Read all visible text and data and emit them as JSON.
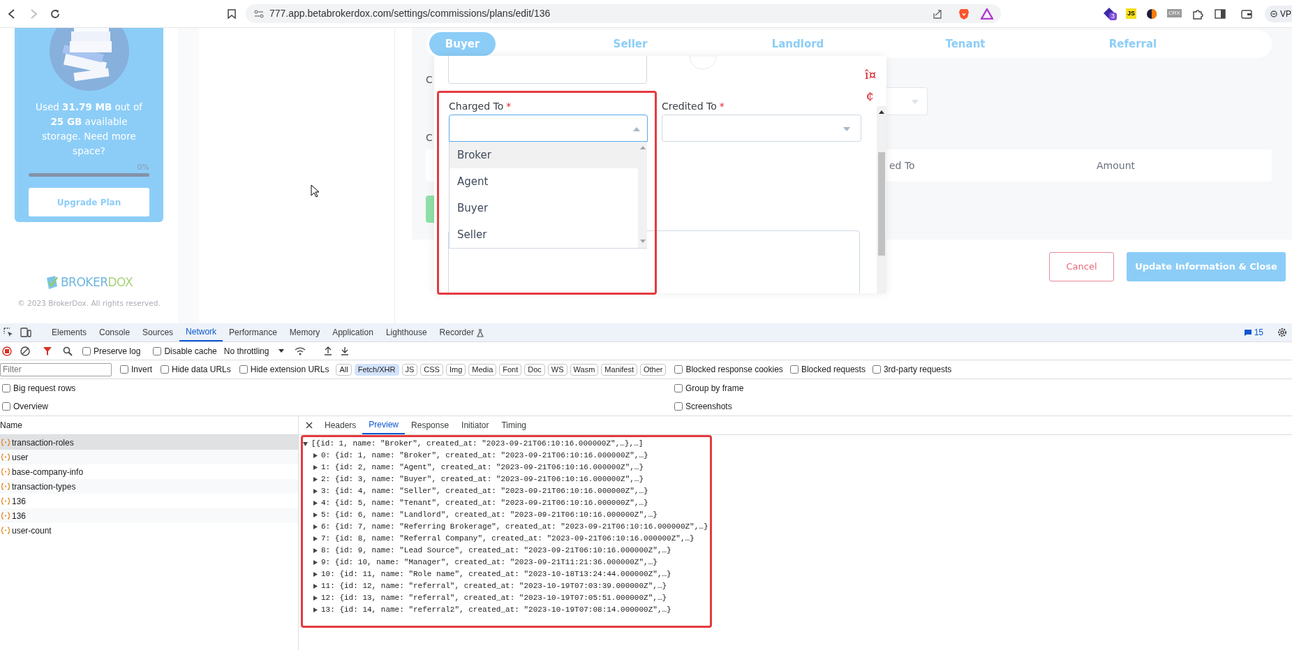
{
  "browser": {
    "url": "777.app.betabrokerdox.com/settings/commissions/plans/edit/136",
    "extension_badge": "3",
    "js_label": "JS",
    "crx_label": "CRX",
    "profile_button": "VP"
  },
  "sidebar": {
    "storage_text": "Used **31.79 MB** out of **25 GB** available storage. Need more space?",
    "usage_percent": "0%",
    "usage": {
      "level": 0
    },
    "upgrade_button": "Upgrade Plan",
    "logo": {
      "part_1": "BROKER",
      "part_2": "DOX"
    },
    "copyright": "© 2023 BrokerDox. All rights reserved."
  },
  "tabs": [
    {
      "label": "Buyer",
      "selected": true
    },
    {
      "label": "Seller",
      "selected": false
    },
    {
      "label": "Landlord",
      "selected": false
    },
    {
      "label": "Tenant",
      "selected": false
    },
    {
      "label": "Referral",
      "selected": false
    }
  ],
  "form": {
    "labels": [
      "C",
      "C"
    ],
    "table_columns": [
      "ed To",
      "Amount"
    ],
    "cancel_button": "Cancel",
    "submit_button": "Update Information & Close"
  },
  "modal": {
    "glyphs": [
      "î¤",
      "¢"
    ],
    "required_mark": "*",
    "fields": [
      {
        "label": "Charged To",
        "required": true,
        "open": true
      },
      {
        "label": "Credited To",
        "required": true,
        "open": false
      }
    ],
    "options": [
      {
        "label": "Broker",
        "selected": true
      },
      {
        "label": "Agent",
        "selected": false
      },
      {
        "label": "Buyer",
        "selected": false
      },
      {
        "label": "Seller",
        "selected": false
      }
    ]
  },
  "devtools": {
    "tabs": [
      {
        "label": "Elements",
        "selected": false
      },
      {
        "label": "Console",
        "selected": false
      },
      {
        "label": "Sources",
        "selected": false
      },
      {
        "label": "Network",
        "selected": true
      },
      {
        "label": "Performance",
        "selected": false
      },
      {
        "label": "Memory",
        "selected": false
      },
      {
        "label": "Application",
        "selected": false
      },
      {
        "label": "Lighthouse",
        "selected": false
      },
      {
        "label": "Recorder",
        "selected": false
      }
    ],
    "issues_count": "15",
    "recording": true,
    "filter_active": true,
    "toolbar_checks": [
      {
        "label": "Preserve log",
        "checked": false
      },
      {
        "label": "Disable cache",
        "checked": false
      }
    ],
    "throttling": "No throttling",
    "filter": {
      "placeholder": "Filter"
    },
    "filter_checks": [
      {
        "label": "Invert",
        "checked": false
      },
      {
        "label": "Hide data URLs",
        "checked": false
      },
      {
        "label": "Hide extension URLs",
        "checked": false
      }
    ],
    "types": [
      {
        "label": "All",
        "selected": false
      },
      {
        "label": "Fetch/XHR",
        "selected": true
      },
      {
        "label": "JS",
        "selected": false
      },
      {
        "label": "CSS",
        "selected": false
      },
      {
        "label": "Img",
        "selected": false
      },
      {
        "label": "Media",
        "selected": false
      },
      {
        "label": "Font",
        "selected": false
      },
      {
        "label": "Doc",
        "selected": false
      },
      {
        "label": "WS",
        "selected": false
      },
      {
        "label": "Wasm",
        "selected": false
      },
      {
        "label": "Manifest",
        "selected": false
      },
      {
        "label": "Other",
        "selected": false
      }
    ],
    "blocked_checks": [
      {
        "label": "Blocked response cookies",
        "checked": false
      },
      {
        "label": "Blocked requests",
        "checked": false
      },
      {
        "label": "3rd-party requests",
        "checked": false
      }
    ],
    "options": [
      {
        "label": "Big request rows",
        "checked": false
      },
      {
        "label": "Group by frame",
        "checked": false
      },
      {
        "label": "Overview",
        "checked": false
      },
      {
        "label": "Screenshots",
        "checked": false
      }
    ],
    "requests": {
      "header": "Name",
      "rows": [
        {
          "name": "transaction-roles",
          "selected": true
        },
        {
          "name": "user",
          "selected": false
        },
        {
          "name": "base-company-info",
          "selected": false
        },
        {
          "name": "transaction-types",
          "selected": false
        },
        {
          "name": "136",
          "selected": false
        },
        {
          "name": "136",
          "selected": false
        },
        {
          "name": "user-count",
          "selected": false
        }
      ]
    },
    "detail_tabs": [
      {
        "label": "Headers",
        "selected": false
      },
      {
        "label": "Preview",
        "selected": true
      },
      {
        "label": "Response",
        "selected": false
      },
      {
        "label": "Initiator",
        "selected": false
      },
      {
        "label": "Timing",
        "selected": false
      }
    ],
    "preview": {
      "root": {
        "text": "[{id: 1, name: \"Broker\", created_at: \"2023-09-21T06:10:16.000000Z\",…},…]",
        "expanded": true
      },
      "children": [
        {
          "text": "0: {id: 1, name: \"Broker\", created_at: \"2023-09-21T06:10:16.000000Z\",…}",
          "expanded": false
        },
        {
          "text": "1: {id: 2, name: \"Agent\", created_at: \"2023-09-21T06:10:16.000000Z\",…}",
          "expanded": false
        },
        {
          "text": "2: {id: 3, name: \"Buyer\", created_at: \"2023-09-21T06:10:16.000000Z\",…}",
          "expanded": false
        },
        {
          "text": "3: {id: 4, name: \"Seller\", created_at: \"2023-09-21T06:10:16.000000Z\",…}",
          "expanded": false
        },
        {
          "text": "4: {id: 5, name: \"Tenant\", created_at: \"2023-09-21T06:10:16.000000Z\",…}",
          "expanded": false
        },
        {
          "text": "5: {id: 6, name: \"Landlord\", created_at: \"2023-09-21T06:10:16.000000Z\",…}",
          "expanded": false
        },
        {
          "text": "6: {id: 7, name: \"Referring Brokerage\", created_at: \"2023-09-21T06:10:16.000000Z\",…}",
          "expanded": false
        },
        {
          "text": "7: {id: 8, name: \"Referral Company\", created_at: \"2023-09-21T06:10:16.000000Z\",…}",
          "expanded": false
        },
        {
          "text": "8: {id: 9, name: \"Lead Source\", created_at: \"2023-09-21T06:10:16.000000Z\",…}",
          "expanded": false
        },
        {
          "text": "9: {id: 10, name: \"Manager\", created_at: \"2023-09-21T11:21:36.000000Z\",…}",
          "expanded": false
        },
        {
          "text": "10: {id: 11, name: \"Role name\", created_at: \"2023-10-18T13:24:44.000000Z\",…}",
          "expanded": false
        },
        {
          "text": "11: {id: 12, name: \"referral\", created_at: \"2023-10-19T07:03:39.000000Z\",…}",
          "expanded": false
        },
        {
          "text": "12: {id: 13, name: \"referral\", created_at: \"2023-10-19T07:05:51.000000Z\",…}",
          "expanded": false
        },
        {
          "text": "13: {id: 14, name: \"referral2\", created_at: \"2023-10-19T07:08:14.000000Z\",…}",
          "expanded": false
        }
      ]
    }
  }
}
